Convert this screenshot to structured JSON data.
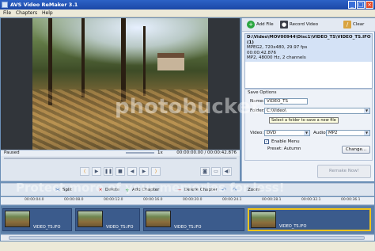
{
  "window": {
    "title": "AVS Video ReMaker 3.1"
  },
  "menu": [
    "File",
    "Chapters",
    "Help"
  ],
  "player": {
    "status": "Paused",
    "speed": "1x",
    "time": "00:00:00.00 / 00:00:42.876"
  },
  "toolbar": {
    "add_file": "Add File",
    "record_video": "Record Video",
    "clear": "Clear"
  },
  "file_info": {
    "path": "D:\\Video\\MOV00944\\Disc1\\VIDEO_TS\\VIDEO_TS.IFO (1)",
    "video": "MPEG2, 720x480, 29.97 fps",
    "duration": "00:00:42.876",
    "audio": "MP2, 48000 Hz, 2 channels"
  },
  "save_options": {
    "header": "Save Options",
    "name_label": "Name:",
    "name_value": "VIDEO_TS",
    "folder_label": "Folder:",
    "folder_value": "C:\\Video\\",
    "folder_tooltip": "Select a folder to save a new file",
    "video_label": "Video:",
    "video_value": "DVD",
    "audio_label": "Audio:",
    "audio_value": "MP2",
    "enable_menu": "Enable Menu",
    "preset": "Preset: Autumn",
    "change_button": "Change..."
  },
  "remake_button": "Remake Now!",
  "edit_toolbar": {
    "split": "Split",
    "delete": "Delete",
    "add_chapter": "Add Chapter",
    "delete_chapter": "Delete Chapter",
    "zoom": "Zoom"
  },
  "ruler_ticks": [
    "00:00:04.0",
    "00:00:08.0",
    "00:00:12.0",
    "00:00:16.0",
    "00:00:20.0",
    "00:00:24.1",
    "00:00:28.1",
    "00:00:32.1",
    "00:00:36.1"
  ],
  "clips": [
    "VIDEO_TS.IFO",
    "VIDEO_TS.IFO",
    "VIDEO_TS.IFO",
    "VIDEO_TS.IFO"
  ],
  "watermark": {
    "top": "photobucket",
    "bottom": "Protect more of your memories for less!"
  },
  "colors": {
    "titlebar": "#2d62c6",
    "selected_clip_border": "#f0c419",
    "timeline_bg": "#5d7fa8"
  }
}
